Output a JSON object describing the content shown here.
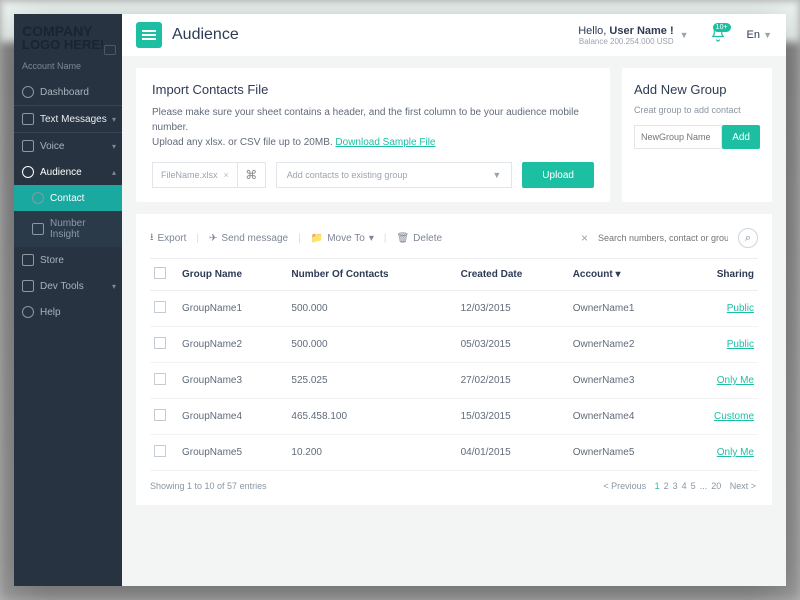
{
  "sidebar": {
    "logo1": "COMPANY",
    "logo2": "LOGO HERE!",
    "account": "Account Name",
    "items": {
      "dashboard": "Dashboard",
      "text_messages": "Text Messages",
      "voice": "Voice",
      "audience": "Audience",
      "contact": "Contact",
      "number_insight": "Number Insight",
      "store": "Store",
      "dev_tools": "Dev Tools",
      "help": "Help"
    }
  },
  "header": {
    "title": "Audience",
    "hello_prefix": "Hello, ",
    "username": "User Name !",
    "balance": "Balance 200.254.000 USD",
    "notif_count": "10+",
    "lang": "En"
  },
  "import": {
    "title": "Import Contacts File",
    "desc1": "Please make sure your sheet contains a header, and the first column to be your audience mobile number.",
    "desc2_a": "Upload any xlsx. or CSV file up to 20MB. ",
    "download": "Download Sample File",
    "filename": "FileName.xlsx",
    "select_placeholder": "Add contacts to existing group",
    "upload": "Upload"
  },
  "addgroup": {
    "title": "Add New Group",
    "sub": "Creat group to add contact",
    "placeholder": "NewGroup Name",
    "btn": "Add"
  },
  "toolbar": {
    "export": "Export",
    "send": "Send message",
    "move": "Move To",
    "delete": "Delete",
    "search_ph": "Search numbers, contact or groups"
  },
  "table": {
    "headers": {
      "group": "Group Name",
      "num": "Number Of Contacts",
      "date": "Created Date",
      "acct": "Account",
      "share": "Sharing"
    },
    "rows": [
      {
        "group": "GroupName1",
        "num": "500.000",
        "date": "12/03/2015",
        "acct": "OwnerName1",
        "share": "Public"
      },
      {
        "group": "GroupName2",
        "num": "500.000",
        "date": "05/03/2015",
        "acct": "OwnerName2",
        "share": "Public"
      },
      {
        "group": "GroupName3",
        "num": "525.025",
        "date": "27/02/2015",
        "acct": "OwnerName3",
        "share": "Only Me"
      },
      {
        "group": "GroupName4",
        "num": "465.458.100",
        "date": "15/03/2015",
        "acct": "OwnerName4",
        "share": "Custome"
      },
      {
        "group": "GroupName5",
        "num": "10.200",
        "date": "04/01/2015",
        "acct": "OwnerName5",
        "share": "Only Me"
      }
    ],
    "showing": "Showing 1 to 10 of 57 entries",
    "pager": {
      "prev": "< Previous",
      "pages": [
        "1",
        "2",
        "3",
        "4",
        "5",
        "...",
        "20"
      ],
      "next": "Next >"
    }
  }
}
